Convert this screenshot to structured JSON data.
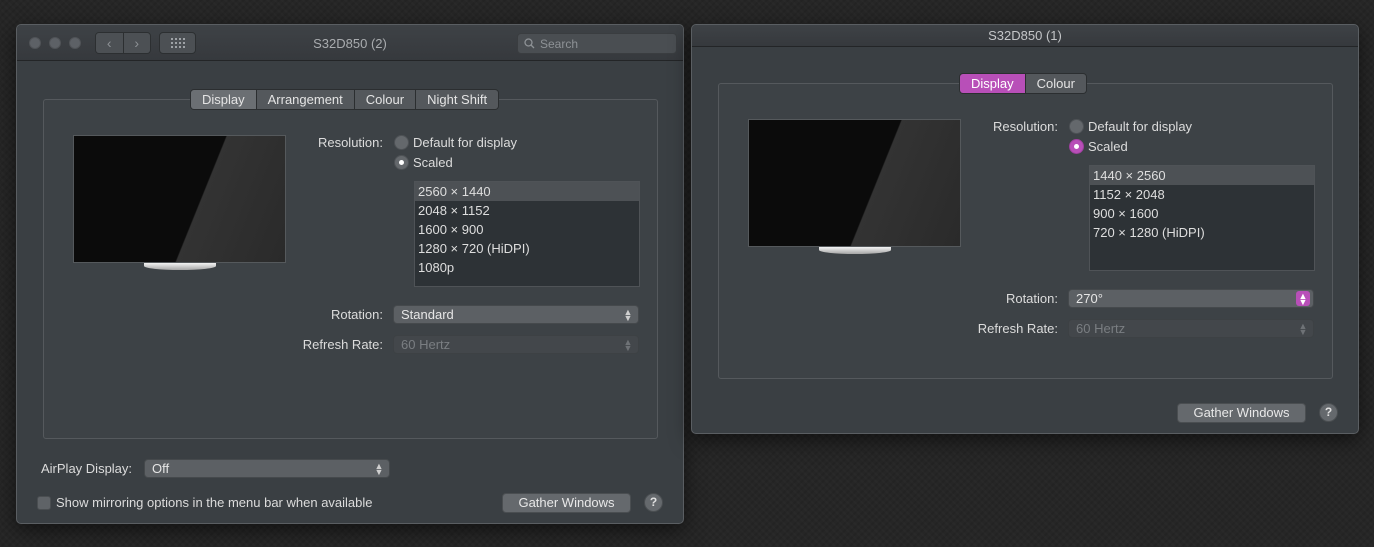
{
  "window1": {
    "title": "S32D850 (2)",
    "search_placeholder": "Search",
    "tabs": [
      "Display",
      "Arrangement",
      "Colour",
      "Night Shift"
    ],
    "selected_tab": "Display",
    "resolution_label": "Resolution:",
    "default_option": "Default for display",
    "scaled_option": "Scaled",
    "selected_resolution_mode": "Scaled",
    "resolutions": [
      "2560 × 1440",
      "2048 × 1152",
      "1600 × 900",
      "1280 × 720 (HiDPI)",
      "1080p"
    ],
    "selected_resolution": "2560 × 1440",
    "rotation_label": "Rotation:",
    "rotation_value": "Standard",
    "refresh_label": "Refresh Rate:",
    "refresh_value": "60 Hertz",
    "airplay_label": "AirPlay Display:",
    "airplay_value": "Off",
    "mirroring_label": "Show mirroring options in the menu bar when available",
    "gather_label": "Gather Windows",
    "help_label": "?"
  },
  "window2": {
    "title": "S32D850 (1)",
    "tabs": [
      "Display",
      "Colour"
    ],
    "selected_tab": "Display",
    "resolution_label": "Resolution:",
    "default_option": "Default for display",
    "scaled_option": "Scaled",
    "selected_resolution_mode": "Scaled",
    "resolutions": [
      "1440 × 2560",
      "1152 × 2048",
      "900 × 1600",
      "720 × 1280 (HiDPI)"
    ],
    "selected_resolution": "1440 × 2560",
    "rotation_label": "Rotation:",
    "rotation_value": "270°",
    "refresh_label": "Refresh Rate:",
    "refresh_value": "60 Hertz",
    "gather_label": "Gather Windows",
    "help_label": "?"
  },
  "colors": {
    "accent_pink": "#b84fb8",
    "window_bg": "#3a3f43"
  }
}
